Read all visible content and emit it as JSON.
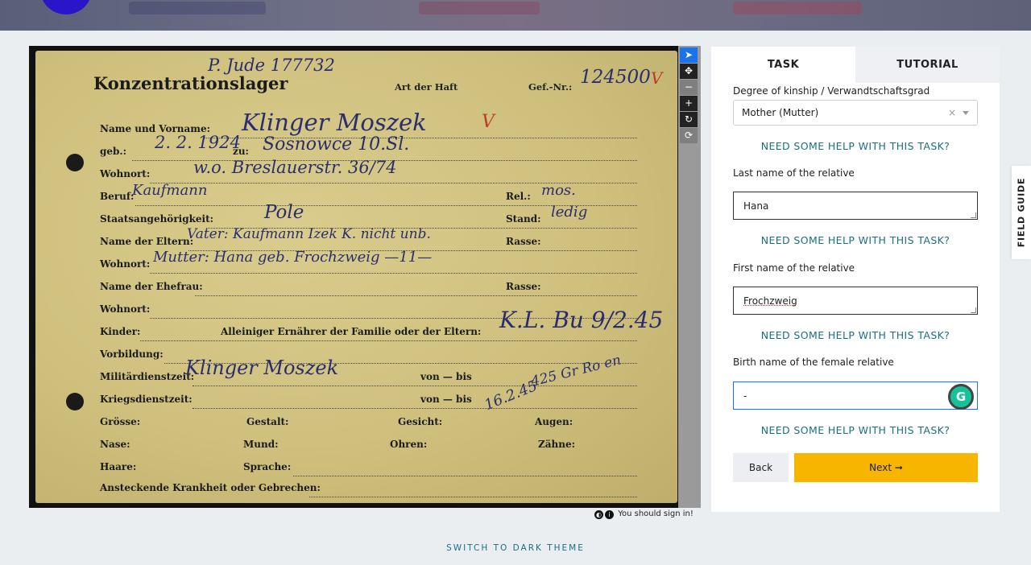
{
  "viewer": {
    "card": {
      "title": "Konzentrationslager",
      "art_der_haft": "Art der Haft",
      "gef_nr": "Gef.-Nr.:",
      "rows": {
        "name": "Name und Vorname:",
        "geb": "geb.:",
        "zu": "zu:",
        "wohnort1": "Wohnort:",
        "beruf": "Beruf:",
        "rel": "Rel.:",
        "staat": "Staatsangehörigkeit:",
        "stand": "Stand:",
        "eltern": "Name der Eltern:",
        "rasse1": "Rasse:",
        "wohnort2": "Wohnort:",
        "ehefrau": "Name der Ehefrau:",
        "rasse2": "Rasse:",
        "wohnort3": "Wohnort:",
        "kinder": "Kinder:",
        "ernaehrer": "Alleiniger Ernährer der Familie oder der Eltern:",
        "vorbildung": "Vorbildung:",
        "militaer": "Militärdienstzeit:",
        "von1": "von — bis",
        "krieg": "Kriegsdienstzeit:",
        "von2": "von — bis",
        "groesse": "Grösse:",
        "gestalt": "Gestalt:",
        "gesicht": "Gesicht:",
        "augen": "Augen:",
        "nase": "Nase:",
        "mund": "Mund:",
        "ohren": "Ohren:",
        "zaehne": "Zähne:",
        "haare": "Haare:",
        "sprache": "Sprache:",
        "krankheit": "Ansteckende Krankheit oder Gebrechen:"
      },
      "handwriting": {
        "jude": "P. Jude 177732",
        "number": "124500",
        "name": "Klinger Moszek",
        "geb": "2. 2. 1924",
        "zu": "Sosnowce 10.Sl.",
        "wohnort1": "w.o. Breslauerstr. 36/74",
        "beruf": "Kaufmann",
        "rel": "mos.",
        "staat": "Pole",
        "stand": "ledig",
        "eltern": "Vater: Kaufmann Izek K. nicht unb.",
        "wohnort2": "Mutter: Hana geb. Frochzweig —11—",
        "kl": "K.L. Bu 9/2.45",
        "sig": "Klinger Moszek",
        "date": "16.2.45",
        "annot": "425 Gr Ro en"
      }
    },
    "tools": [
      "pointer",
      "move",
      "minus",
      "plus",
      "reset",
      "rotate"
    ],
    "signin_text": "You should sign in!"
  },
  "panel": {
    "tabs": [
      "TASK",
      "TUTORIAL"
    ],
    "kinship_label": "Degree of kinship / Verwandtschaftsgrad",
    "kinship_value": "Mother (Mutter)",
    "clear_symbol": "×",
    "help_text": "NEED SOME HELP WITH THIS TASK?",
    "last_name_label": "Last name of the relative",
    "last_name_value": "Hana",
    "first_name_label": "First name of the relative",
    "first_name_value": "Frochzweig",
    "birth_name_label": "Birth name of the female relative",
    "birth_name_value": "-",
    "back_label": "Back",
    "next_label": "Next ➞"
  },
  "field_guide": "FIELD GUIDE",
  "theme_switch": "SWITCH TO DARK THEME",
  "colors": {
    "accent_teal": "#1b6f83",
    "next_button": "#f7b500",
    "focus_blue": "#1a73e8",
    "grammarly_green": "#15c39a"
  }
}
